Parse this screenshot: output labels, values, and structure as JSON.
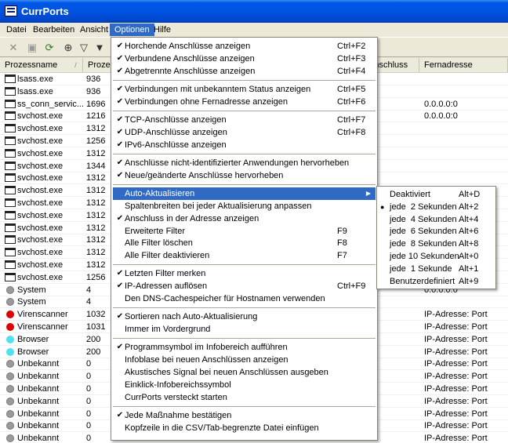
{
  "window": {
    "title": "CurrPorts"
  },
  "menubar": [
    {
      "label": "Datei"
    },
    {
      "label": "Bearbeiten"
    },
    {
      "label": "Ansicht"
    },
    {
      "label": "Optionen"
    },
    {
      "label": "Hilfe"
    }
  ],
  "toolbar": [
    {
      "icon": "delete-icon",
      "glyph": "✕"
    },
    {
      "icon": "save-icon",
      "glyph": "▣"
    },
    {
      "icon": "refresh-icon",
      "glyph": "⟳"
    },
    {
      "icon": "properties-icon",
      "glyph": "⊕"
    },
    {
      "icon": "filter-icon",
      "glyph": "▽"
    },
    {
      "icon": "filter-clear-icon",
      "glyph": "▼"
    }
  ],
  "columns": {
    "name": "Prozessname",
    "pid": "Proze",
    "remote_port": "Anschluss",
    "remote_addr": "Fernadresse"
  },
  "rows": [
    {
      "icon": "win",
      "name": "lsass.exe",
      "pid": "936",
      "remote": ""
    },
    {
      "icon": "win",
      "name": "lsass.exe",
      "pid": "936",
      "remote": ""
    },
    {
      "icon": "win",
      "name": "ss_conn_servic...",
      "pid": "1696",
      "remote": "0.0.0.0:0"
    },
    {
      "icon": "win",
      "name": "svchost.exe",
      "pid": "1216",
      "remote": "0.0.0.0:0"
    },
    {
      "icon": "win",
      "name": "svchost.exe",
      "pid": "1312",
      "remote": ""
    },
    {
      "icon": "win",
      "name": "svchost.exe",
      "pid": "1256",
      "remote": ""
    },
    {
      "icon": "win",
      "name": "svchost.exe",
      "pid": "1312",
      "remote": ""
    },
    {
      "icon": "win",
      "name": "svchost.exe",
      "pid": "1344",
      "remote": ""
    },
    {
      "icon": "win",
      "name": "svchost.exe",
      "pid": "1312",
      "remote": ""
    },
    {
      "icon": "win",
      "name": "svchost.exe",
      "pid": "1312",
      "remote": ""
    },
    {
      "icon": "win",
      "name": "svchost.exe",
      "pid": "1312",
      "remote": ""
    },
    {
      "icon": "win",
      "name": "svchost.exe",
      "pid": "1312",
      "remote": ""
    },
    {
      "icon": "win",
      "name": "svchost.exe",
      "pid": "1312",
      "remote": ""
    },
    {
      "icon": "win",
      "name": "svchost.exe",
      "pid": "1312",
      "remote": ""
    },
    {
      "icon": "win",
      "name": "svchost.exe",
      "pid": "1312",
      "remote": ""
    },
    {
      "icon": "win",
      "name": "svchost.exe",
      "pid": "1312",
      "remote": ""
    },
    {
      "icon": "win",
      "name": "svchost.exe",
      "pid": "1256",
      "remote": ""
    },
    {
      "icon": "gray",
      "name": "System",
      "pid": "4",
      "remote": "0.0.0.0:0"
    },
    {
      "icon": "gray",
      "name": "System",
      "pid": "4",
      "remote": ""
    },
    {
      "icon": "red",
      "name": "Virenscanner",
      "pid": "1032",
      "remote": "IP-Adresse: Port"
    },
    {
      "icon": "red",
      "name": "Virenscanner",
      "pid": "1031",
      "remote": "IP-Adresse: Port"
    },
    {
      "icon": "cyan",
      "name": "Browser",
      "pid": "200",
      "remote": "IP-Adresse: Port"
    },
    {
      "icon": "cyan",
      "name": "Browser",
      "pid": "200",
      "remote": "IP-Adresse: Port"
    },
    {
      "icon": "gray",
      "name": "Unbekannt",
      "pid": "0",
      "remote": "IP-Adresse: Port"
    },
    {
      "icon": "gray",
      "name": "Unbekannt",
      "pid": "0",
      "remote": "IP-Adresse: Port"
    },
    {
      "icon": "gray",
      "name": "Unbekannt",
      "pid": "0",
      "remote": "IP-Adresse: Port"
    },
    {
      "icon": "gray",
      "name": "Unbekannt",
      "pid": "0",
      "remote": "IP-Adresse: Port"
    },
    {
      "icon": "gray",
      "name": "Unbekannt",
      "pid": "0",
      "remote": "IP-Adresse: Port"
    },
    {
      "icon": "gray",
      "name": "Unbekannt",
      "pid": "0",
      "remote": "IP-Adresse: Port"
    },
    {
      "icon": "gray",
      "name": "Unbekannt",
      "pid": "0",
      "remote": "IP-Adresse: Port"
    }
  ],
  "options_menu": [
    {
      "label": "Horchende Anschlüsse anzeigen",
      "shortcut": "Ctrl+F2",
      "checked": true
    },
    {
      "label": "Verbundene Anschlüsse anzeigen",
      "shortcut": "Ctrl+F3",
      "checked": true
    },
    {
      "label": "Abgetrennte Anschlüsse anzeigen",
      "shortcut": "Ctrl+F4",
      "checked": true
    },
    {
      "separator": true
    },
    {
      "label": "Verbindungen mit unbekanntem Status anzeigen",
      "shortcut": "Ctrl+F5",
      "checked": true
    },
    {
      "label": "Verbindungen ohne Fernadresse anzeigen",
      "shortcut": "Ctrl+F6",
      "checked": true
    },
    {
      "separator": true
    },
    {
      "label": "TCP-Anschlüsse anzeigen",
      "shortcut": "Ctrl+F7",
      "checked": true
    },
    {
      "label": "UDP-Anschlüsse anzeigen",
      "shortcut": "Ctrl+F8",
      "checked": true
    },
    {
      "label": "IPv6-Anschlüsse anzeigen",
      "shortcut": "",
      "checked": true
    },
    {
      "separator": true
    },
    {
      "label": "Anschlüsse nicht-identifizierter Anwendungen hervorheben",
      "shortcut": "",
      "checked": true
    },
    {
      "label": "Neue/geänderte Anschlüsse hervorheben",
      "shortcut": "",
      "checked": true
    },
    {
      "separator": true
    },
    {
      "label": "Auto-Aktualisieren",
      "shortcut": "",
      "checked": false,
      "submenu": true,
      "highlighted": true
    },
    {
      "label": "Spaltenbreiten bei jeder Aktualisierung anpassen",
      "shortcut": "",
      "checked": false
    },
    {
      "label": "Anschluss in der Adresse anzeigen",
      "shortcut": "",
      "checked": true
    },
    {
      "label": "Erweiterte Filter",
      "shortcut": "F9",
      "checked": false
    },
    {
      "label": "Alle Filter löschen",
      "shortcut": "F8",
      "checked": false
    },
    {
      "label": "Alle Filter deaktivieren",
      "shortcut": "F7",
      "checked": false
    },
    {
      "separator": true
    },
    {
      "label": "Letzten Filter merken",
      "shortcut": "",
      "checked": true
    },
    {
      "label": "IP-Adressen auflösen",
      "shortcut": "Ctrl+F9",
      "checked": true
    },
    {
      "label": "Den DNS-Cachespeicher für Hostnamen verwenden",
      "shortcut": "",
      "checked": false
    },
    {
      "separator": true
    },
    {
      "label": "Sortieren nach Auto-Aktualisierung",
      "shortcut": "",
      "checked": true
    },
    {
      "label": "Immer im Vordergrund",
      "shortcut": "",
      "checked": false
    },
    {
      "separator": true
    },
    {
      "label": "Programmsymbol im Infobereich aufführen",
      "shortcut": "",
      "checked": true
    },
    {
      "label": "Infoblase bei neuen Anschlüssen anzeigen",
      "shortcut": "",
      "checked": false
    },
    {
      "label": "Akustisches Signal bei neuen Anschlüssen ausgeben",
      "shortcut": "",
      "checked": false
    },
    {
      "label": "Einklick-Infobereichssymbol",
      "shortcut": "",
      "checked": false
    },
    {
      "label": "CurrPorts versteckt starten",
      "shortcut": "",
      "checked": false
    },
    {
      "separator": true
    },
    {
      "label": "Jede Maßnahme bestätigen",
      "shortcut": "",
      "checked": true
    },
    {
      "label": "Kopfzeile in die CSV/Tab-begrenzte Datei einfügen",
      "shortcut": "",
      "checked": false
    }
  ],
  "auto_refresh_submenu": [
    {
      "label": "Deaktiviert",
      "shortcut": "Alt+D",
      "selected": false
    },
    {
      "label": "jede  2 Sekunden",
      "shortcut": "Alt+2",
      "selected": true
    },
    {
      "label": "jede  4 Sekunden",
      "shortcut": "Alt+4",
      "selected": false
    },
    {
      "label": "jede  6 Sekunden",
      "shortcut": "Alt+6",
      "selected": false
    },
    {
      "label": "jede  8 Sekunden",
      "shortcut": "Alt+8",
      "selected": false
    },
    {
      "label": "jede 10 Sekunden",
      "shortcut": "Alt+0",
      "selected": false
    },
    {
      "label": "jede  1 Sekunde",
      "shortcut": "Alt+1",
      "selected": false
    },
    {
      "label": "Benutzerdefiniert",
      "shortcut": "Alt+9",
      "selected": false
    }
  ],
  "colors": {
    "title_blue": "#0053e1",
    "highlight": "#316ac5",
    "red_dot": "#e00000",
    "cyan_dot": "#50e0f0",
    "gray_dot": "#9a9a9a"
  }
}
